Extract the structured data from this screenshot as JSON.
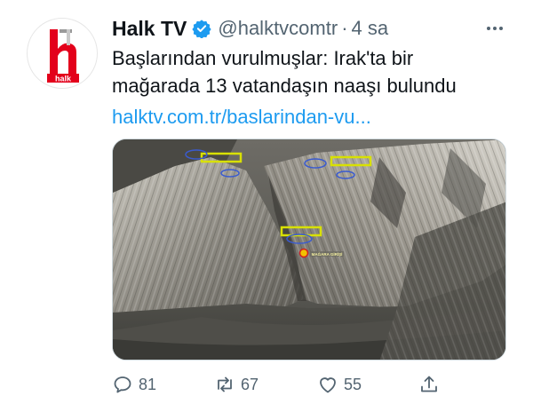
{
  "tweet": {
    "account": {
      "display_name": "Halk TV",
      "handle": "@halktvcomtr",
      "time": "4 sa",
      "separator": "·",
      "avatar_logo_text": "halk",
      "verified": true
    },
    "text_line1": "Başlarından vurulmuşlar: Irak'ta bir",
    "text_line2": "mağarada 13 vatandaşın naaşı bulundu",
    "link": "halktv.com.tr/baslarindan-vu...",
    "media": {
      "annotation_label": "MAĞARA GİRİŞİ"
    },
    "actions": {
      "reply_count": "81",
      "retweet_count": "67",
      "like_count": "55"
    }
  },
  "colors": {
    "brand_red": "#e3001b",
    "link": "#1d9bf0",
    "verified": "#1d9bf0",
    "muted": "#536471",
    "annotation_yellow": "#d8e000"
  }
}
